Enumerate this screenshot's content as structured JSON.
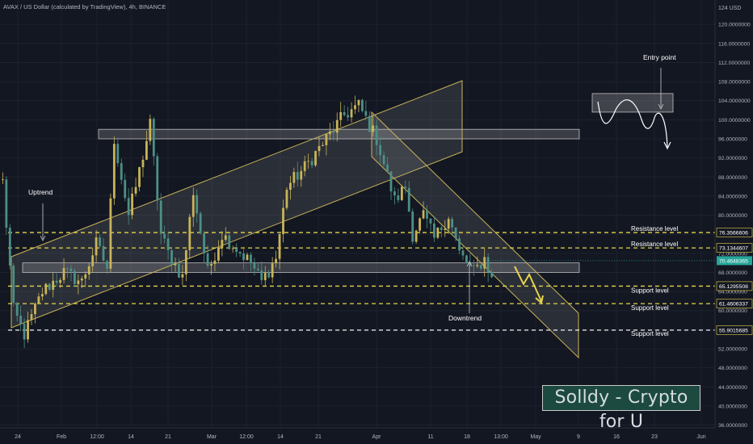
{
  "header": {
    "title": "AVAX / US Dollar (calculated by TradingView), 4h, BINANCE"
  },
  "watermark": {
    "text": "Solldy - Crypto for U"
  },
  "colors": {
    "background": "#131722",
    "grid": "#1e222d",
    "up_candle": "#c9b458",
    "down_candle": "#4c8f86",
    "channel_line": "#c9b458",
    "level_line": "#e6d44a",
    "last_price": "#26a69a",
    "arrow": "#e6d44a"
  },
  "chart_data": {
    "type": "candlestick",
    "symbol": "AVAX / US Dollar",
    "timeframe": "4h",
    "exchange": "BINANCE",
    "y_axis": {
      "unit": "USD",
      "unit_label": "124 USD",
      "ticks": [
        "36.0000000",
        "40.0000000",
        "44.0000000",
        "48.0000000",
        "52.0000000",
        "56.0000000",
        "60.0000000",
        "64.0000000",
        "68.0000000",
        "72.0000000",
        "76.0000000",
        "80.0000000",
        "84.0000000",
        "88.0000000",
        "92.0000000",
        "96.0000000",
        "100.0000000",
        "104.0000000",
        "108.0000000",
        "112.0000000",
        "116.0000000",
        "120.0000000"
      ],
      "ylim": [
        35,
        124.5
      ]
    },
    "x_axis": {
      "ticks": [
        "24",
        "Feb",
        "12:00",
        "14",
        "21",
        "Mar",
        "12:00",
        "14",
        "21",
        "Apr",
        "11",
        "18",
        "13:00",
        "May",
        "9",
        "16",
        "23",
        "Jun"
      ]
    },
    "price_path": [
      [
        0,
        87
      ],
      [
        3,
        60
      ],
      [
        6,
        55
      ],
      [
        11,
        64
      ],
      [
        17,
        68
      ],
      [
        22,
        66
      ],
      [
        26,
        74
      ],
      [
        29,
        69
      ],
      [
        31,
        96
      ],
      [
        35,
        80
      ],
      [
        37,
        86
      ],
      [
        41,
        99
      ],
      [
        44,
        76
      ],
      [
        46,
        72
      ],
      [
        50,
        67
      ],
      [
        53,
        85
      ],
      [
        57,
        68
      ],
      [
        61,
        76
      ],
      [
        65,
        73
      ],
      [
        69,
        70
      ],
      [
        72,
        66
      ],
      [
        76,
        71
      ],
      [
        79,
        86
      ],
      [
        84,
        90
      ],
      [
        90,
        96
      ],
      [
        95,
        101
      ],
      [
        99,
        103
      ],
      [
        104,
        96
      ],
      [
        109,
        83
      ],
      [
        112,
        86
      ],
      [
        114,
        76
      ],
      [
        117,
        80
      ],
      [
        120,
        75
      ],
      [
        124,
        80
      ],
      [
        127,
        72
      ],
      [
        131,
        68
      ],
      [
        134,
        71
      ],
      [
        136,
        67
      ]
    ],
    "last_price": "70.4648365",
    "price_labels": [
      {
        "value": 76.3566606,
        "text": "76.3566606"
      },
      {
        "value": 73.1344607,
        "text": "73.1344607"
      },
      {
        "value": 65.1295508,
        "text": "65.1295508"
      },
      {
        "value": 61.4606337,
        "text": "61.4606337"
      },
      {
        "value": 55.9015685,
        "text": "55.9015685"
      }
    ],
    "levels": [
      {
        "label": "Resistance level",
        "price": 76.3566606
      },
      {
        "label": "Resistance level",
        "price": 73.1344607
      },
      {
        "label": "Support level",
        "price": 65.1295508
      },
      {
        "label": "Support level",
        "price": 61.4606337
      },
      {
        "label": "Support level",
        "price": 55.9015685
      }
    ],
    "zones": [
      {
        "name": "upper resistance zone",
        "from": 96.0,
        "to": 98.0
      },
      {
        "name": "lower support zone",
        "from": 68.0,
        "to": 70.0
      }
    ],
    "annotations": {
      "uptrend": "Uptrend",
      "downtrend": "Downtrend",
      "entry_point": "Entry point"
    }
  }
}
